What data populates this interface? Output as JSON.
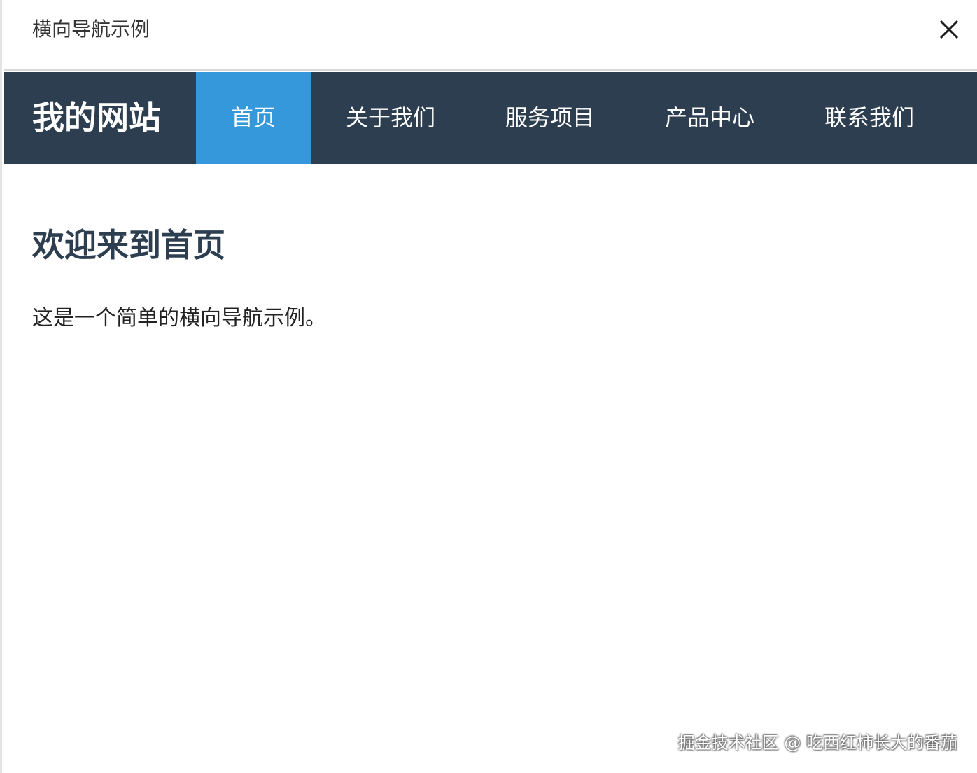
{
  "window": {
    "title": "横向导航示例",
    "close_icon": "close-icon"
  },
  "navbar": {
    "brand": "我的网站",
    "items": [
      {
        "label": "首页",
        "active": true
      },
      {
        "label": "关于我们",
        "active": false
      },
      {
        "label": "服务项目",
        "active": false
      },
      {
        "label": "产品中心",
        "active": false
      },
      {
        "label": "联系我们",
        "active": false
      }
    ],
    "bg_color": "#2c3e50",
    "active_color": "#3498db"
  },
  "main": {
    "heading": "欢迎来到首页",
    "text": "这是一个简单的横向导航示例。"
  },
  "watermark": "掘金技术社区 @ 吃西红柿长大的番茄"
}
